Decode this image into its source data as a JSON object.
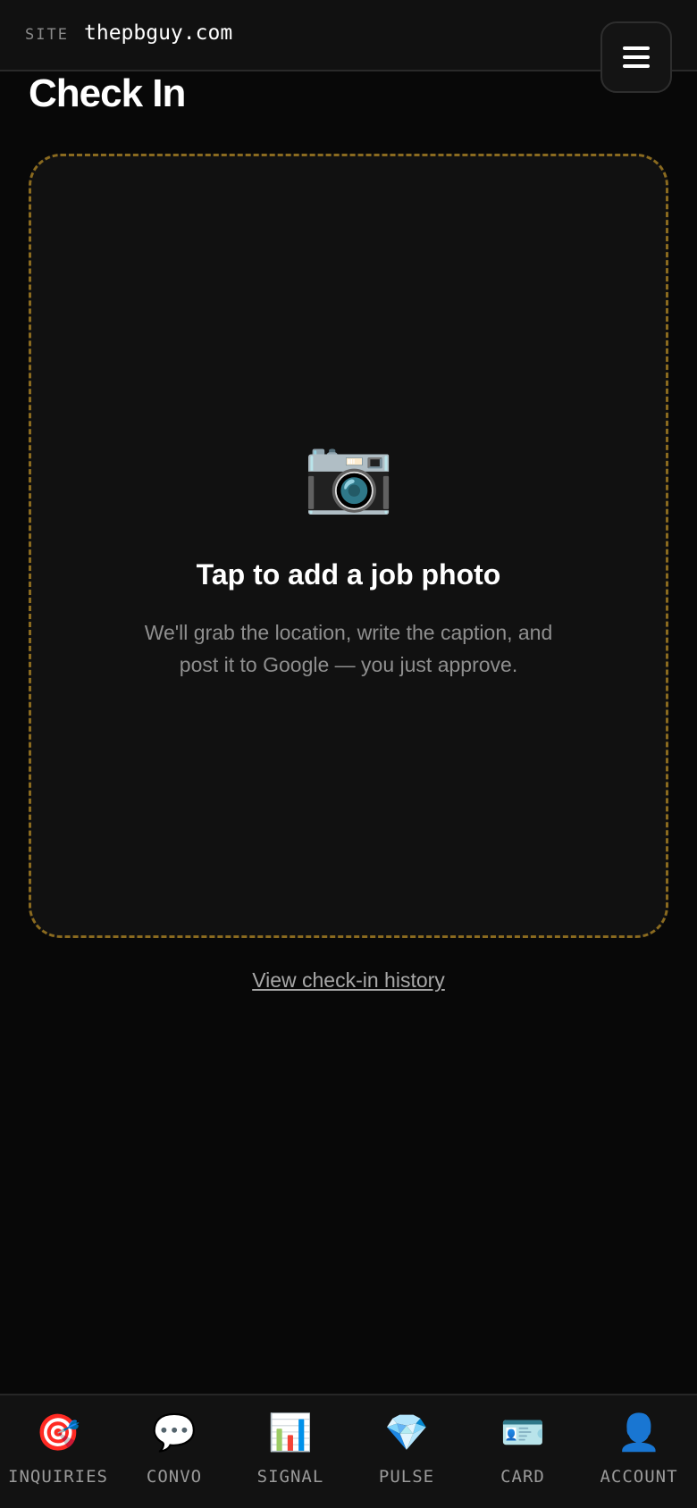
{
  "header": {
    "site_tag": "SITE",
    "domain": "thepbguy.com",
    "menu_icon": "hamburger-menu-icon"
  },
  "page": {
    "title": "Check In"
  },
  "dropzone": {
    "icon": "📷",
    "icon_name": "camera-icon",
    "title": "Tap to add a job photo",
    "description": "We'll grab the location, write the caption, and post it to Google — you just approve.",
    "border_color": "#8a6a1f"
  },
  "history_link": "View check-in history",
  "bottom_nav": {
    "items": [
      {
        "icon": "🎯",
        "icon_name": "target-icon",
        "label": "INQUIRIES"
      },
      {
        "icon": "💬",
        "icon_name": "speech-bubble-icon",
        "label": "CONVO"
      },
      {
        "icon": "📊",
        "icon_name": "bar-chart-icon",
        "label": "SIGNAL"
      },
      {
        "icon": "💎",
        "icon_name": "gem-icon",
        "label": "PULSE"
      },
      {
        "icon": "🪪",
        "icon_name": "id-card-icon",
        "label": "CARD"
      },
      {
        "icon": "👤",
        "icon_name": "user-silhouette-icon",
        "label": "ACCOUNT"
      }
    ]
  }
}
